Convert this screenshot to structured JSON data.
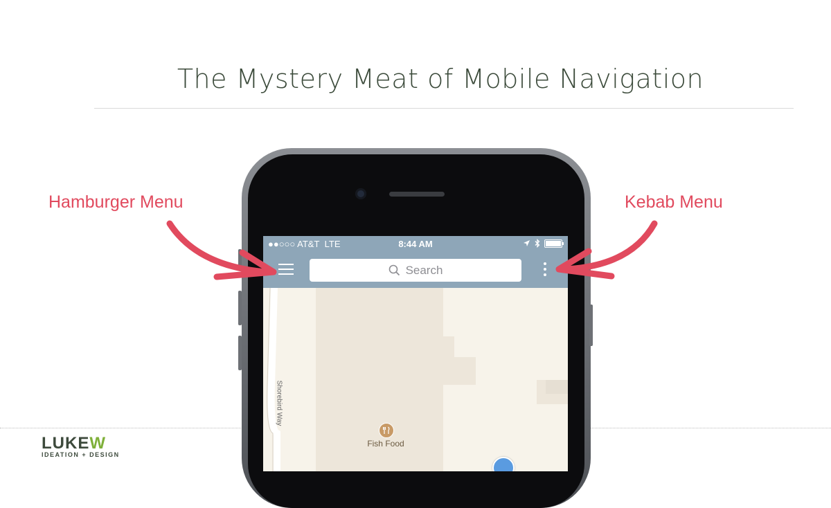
{
  "slide": {
    "title": "The Mystery Meat of Mobile Navigation"
  },
  "callouts": {
    "left": "Hamburger Menu",
    "right": "Kebab Menu"
  },
  "status_bar": {
    "carrier": "●●○○○ AT&T",
    "network": "LTE",
    "time": "8:44 AM"
  },
  "search": {
    "placeholder": "Search"
  },
  "map": {
    "poi_label": "Fish Food",
    "street_label": "Shorebird Way"
  },
  "logo": {
    "main_prefix": "LUKE",
    "main_accent": "W",
    "tagline": "IDEATION + DESIGN"
  },
  "colors": {
    "accent": "#e14a5e",
    "nav_bar": "#8ea6b8",
    "logo_green": "#7fb03a"
  },
  "icons": {
    "hamburger": "hamburger-menu-icon",
    "kebab": "kebab-menu-icon",
    "search": "search-icon",
    "location": "location-arrow-icon",
    "bluetooth": "bluetooth-icon",
    "battery": "battery-icon",
    "poi": "restaurant-icon"
  }
}
